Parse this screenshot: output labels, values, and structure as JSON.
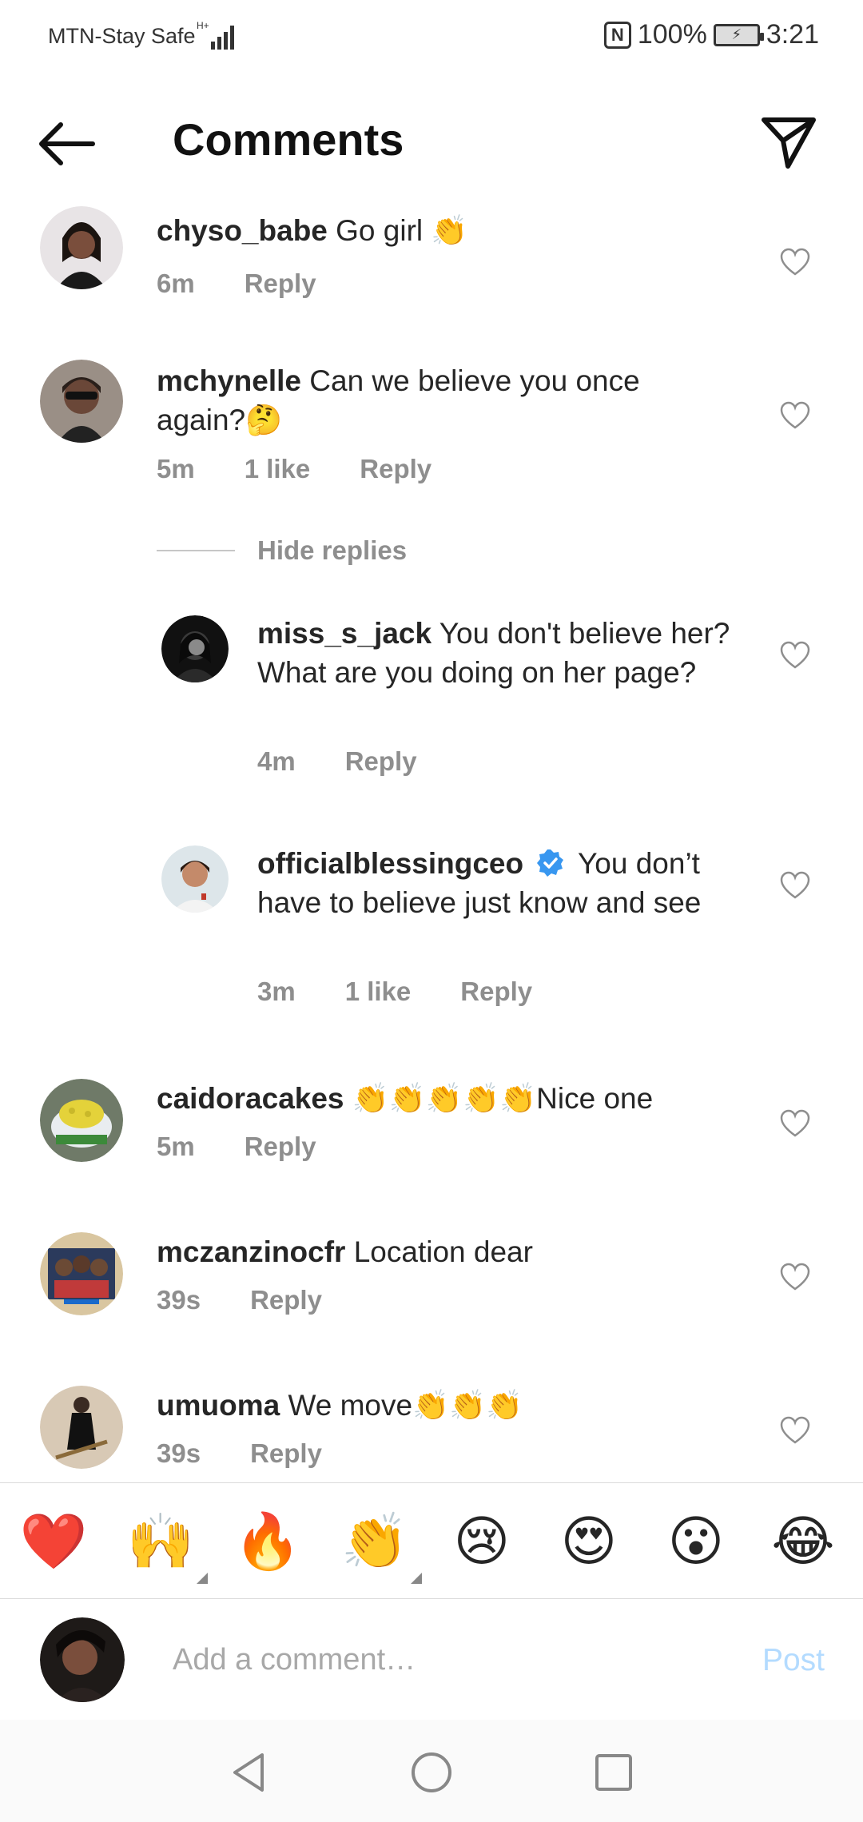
{
  "status_bar": {
    "carrier": "MTN-Stay Safe",
    "network": "H+",
    "battery": "100%",
    "time": "3:21"
  },
  "header": {
    "title": "Comments"
  },
  "comments": [
    {
      "username": "chyso_babe",
      "text": "Go girl",
      "emoji": "👏",
      "time": "6m",
      "reply": "Reply"
    },
    {
      "username": "mchynelle",
      "text": "Can we believe you once again?",
      "emoji": "🤔",
      "time": "5m",
      "likes": "1 like",
      "reply": "Reply"
    },
    {
      "username": "caidoracakes",
      "text": "Nice one",
      "emoji": "👏👏👏👏👏",
      "time": "5m",
      "reply": "Reply"
    },
    {
      "username": "mczanzinocfr",
      "text": "Location dear",
      "time": "39s",
      "reply": "Reply"
    },
    {
      "username": "umuoma",
      "text": "We move",
      "emoji": "👏👏👏",
      "time": "39s",
      "reply": "Reply"
    }
  ],
  "hide_replies": "Hide replies",
  "replies": [
    {
      "username": "miss_s_jack",
      "text": "You don't believe her? What are you doing on her page?",
      "time": "4m",
      "reply": "Reply"
    },
    {
      "username": "officialblessingceo",
      "text": "You don’t have to believe just know and see",
      "time": "3m",
      "likes": "1 like",
      "reply": "Reply"
    }
  ],
  "emoji_bar": [
    "❤️",
    "🙌",
    "🔥",
    "👏",
    "😢",
    "😍",
    "😮",
    "😂"
  ],
  "input": {
    "placeholder": "Add a comment…",
    "post_label": "Post"
  },
  "colors": {
    "accent_disabled": "#b3dbff",
    "verified": "#3897f0",
    "meta_gray": "#8e8e8e"
  }
}
